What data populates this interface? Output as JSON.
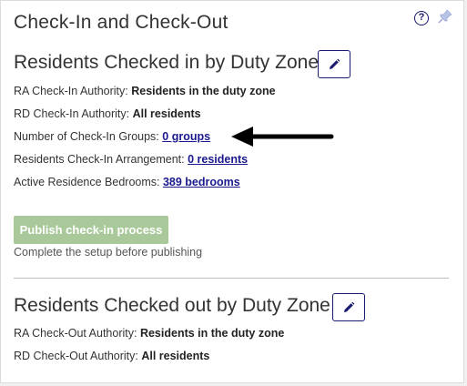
{
  "card": {
    "title": "Check-In and Check-Out",
    "help_icon": "?",
    "pin_icon": "pin-icon"
  },
  "checkin": {
    "heading": "Residents Checked in by Duty Zone",
    "edit_icon": "pencil-icon",
    "rows": [
      {
        "label": "RA Check-In Authority: ",
        "value": "Residents in the duty zone"
      },
      {
        "label": "RD Check-In Authority: ",
        "value": "All residents"
      },
      {
        "label": "Number of Check-In Groups: ",
        "value": "0 groups"
      },
      {
        "label": "Residents Check-In Arrangement: ",
        "value": "0 residents"
      },
      {
        "label": "Active Residence Bedrooms: ",
        "value": "389 bedrooms"
      }
    ],
    "publish_label": "Publish check-in process",
    "publish_hint": "Complete the setup before publishing"
  },
  "checkout": {
    "heading": "Residents Checked out by Duty Zone",
    "edit_icon": "pencil-icon",
    "rows": [
      {
        "label": "RA Check-Out Authority: ",
        "value": "Residents in the duty zone"
      },
      {
        "label": "RD Check-Out Authority: ",
        "value": "All residents"
      }
    ]
  },
  "colors": {
    "accent": "#1a1a6e",
    "link": "#1a1a8e",
    "publish_disabled": "#a9c99a"
  }
}
